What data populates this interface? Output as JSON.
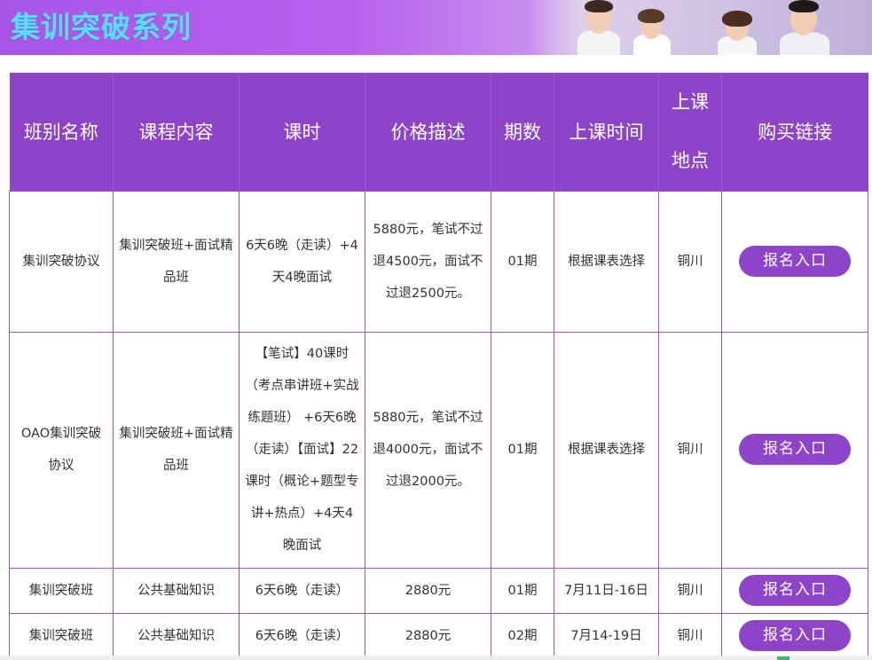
{
  "banner": {
    "title": "集训突破系列"
  },
  "table": {
    "headers": [
      "班别名称",
      "课程内容",
      "课时",
      "价格描述",
      "期数",
      "上课时间",
      "上课地点",
      "购买链接"
    ],
    "rows": [
      {
        "name": "集训突破协议",
        "content": "集训突破班+面试精品班",
        "hours": "6天6晚（走读）+4天4晚面试",
        "price": "5880元，笔试不过退4500元，面试不过退2500元。",
        "period": "01期",
        "time": "根据课表选择",
        "location": "铜川",
        "link": "报名入口"
      },
      {
        "name": "OAO集训突破协议",
        "content": "集训突破班+面试精品班",
        "hours": "【笔试】40课时（考点串讲班+实战练题班） +6天6晚（走读）【面试】22课时（概论+题型专讲+热点）+4天4晚面试",
        "price": "5880元，笔试不过退4000元，面试不过退2000元。",
        "period": "01期",
        "time": "根据课表选择",
        "location": "铜川",
        "link": "报名入口"
      },
      {
        "name": "集训突破班",
        "content": "公共基础知识",
        "hours": "6天6晚（走读）",
        "price": "2880元",
        "period": "01期",
        "time": "7月11日-16日",
        "location": "铜川",
        "link": "报名入口"
      },
      {
        "name": "集训突破班",
        "content": "公共基础知识",
        "hours": "6天6晚（走读）",
        "price": "2880元",
        "period": "02期",
        "time": "7月14-19日",
        "location": "铜川",
        "link": "报名入口"
      }
    ]
  }
}
